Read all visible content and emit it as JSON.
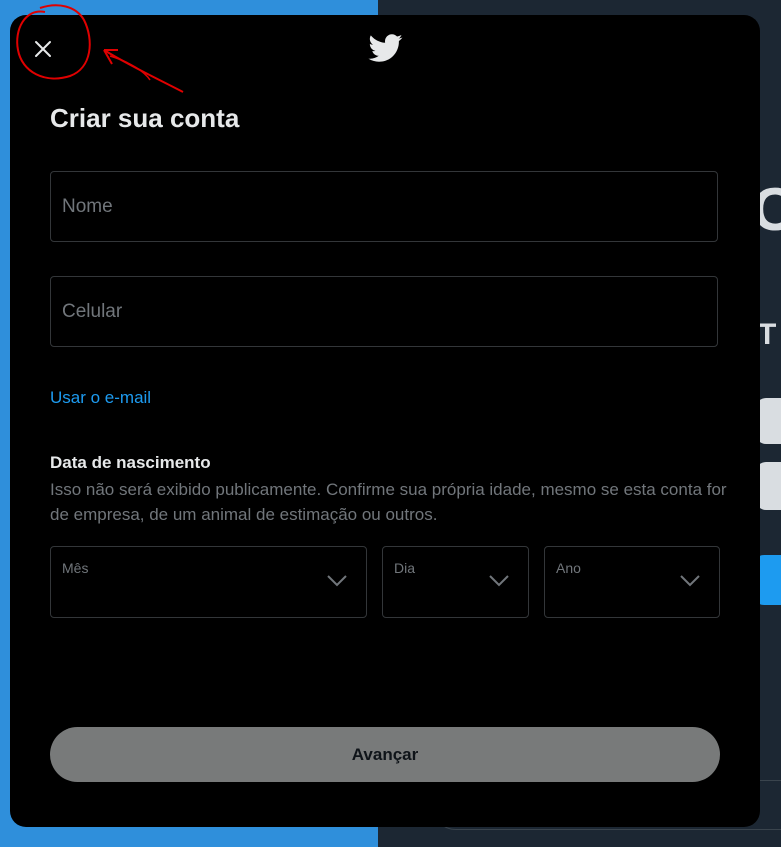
{
  "modal": {
    "title": "Criar sua conta",
    "close_icon": "close-icon",
    "logo_icon": "twitter-bird-icon"
  },
  "form": {
    "name_placeholder": "Nome",
    "phone_placeholder": "Celular",
    "email_link": "Usar o e-mail",
    "dob_title": "Data de nascimento",
    "dob_description": "Isso não será exibido publicamente. Confirme sua própria idade, mesmo se esta conta for de empresa, de um animal de estimação ou outros.",
    "month_label": "Mês",
    "day_label": "Dia",
    "year_label": "Ano",
    "next_button": "Avançar"
  },
  "colors": {
    "modal_bg": "#000000",
    "accent": "#1d9bf0",
    "text_primary": "#e7e9ea",
    "text_secondary": "#71767b",
    "button_disabled": "#787a7a",
    "annotation": "#e00000"
  }
}
